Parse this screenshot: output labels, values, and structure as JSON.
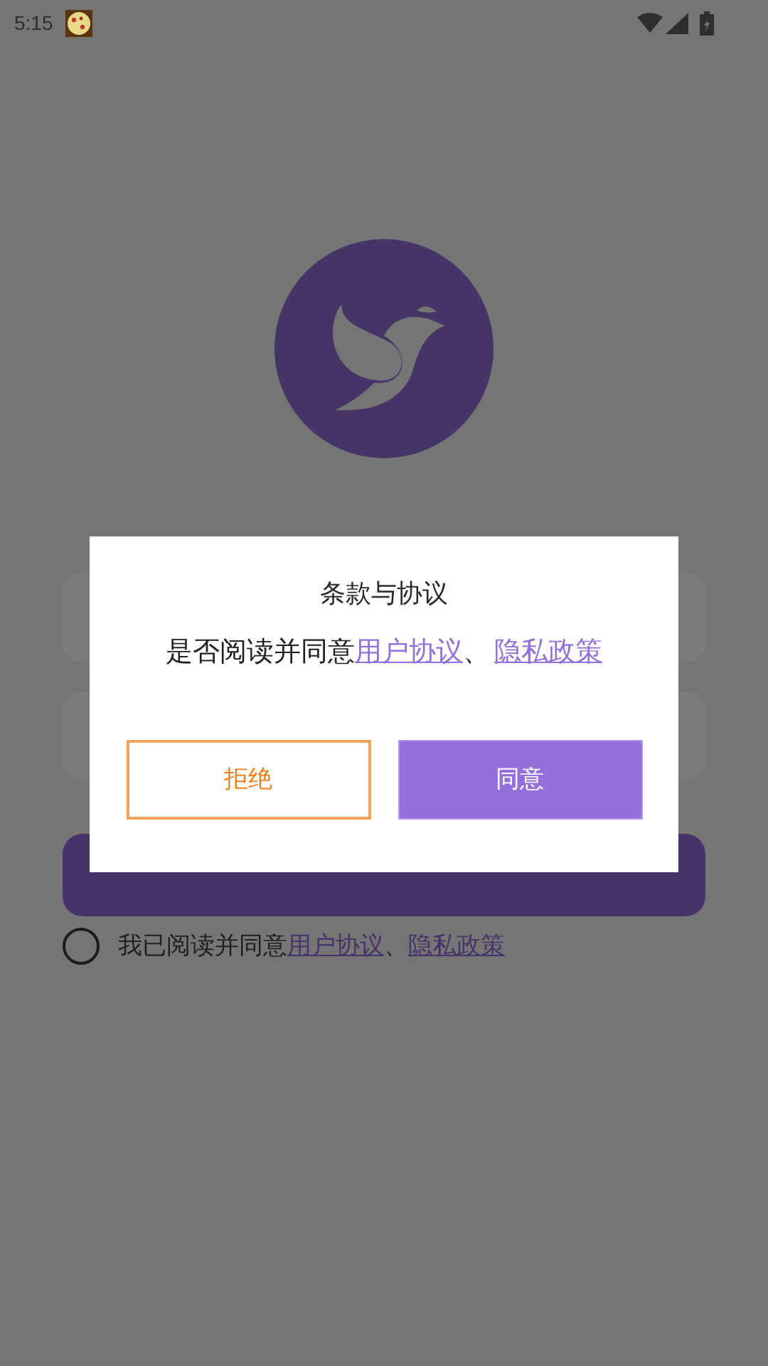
{
  "status_bar": {
    "time": "5:15"
  },
  "login": {
    "agreement": {
      "checked": false,
      "prefix": "我已阅读并同意",
      "links": [
        "用户协议",
        "隐私政策"
      ],
      "separator": "、"
    }
  },
  "dialog": {
    "title": "条款与协议",
    "message": {
      "prefix": "是否阅读并同意",
      "links": [
        "用户协议",
        "隐私政策"
      ],
      "separator": "、"
    },
    "buttons": [
      {
        "label": "拒绝",
        "kind": "outline"
      },
      {
        "label": "同意",
        "kind": "primary"
      }
    ]
  }
}
